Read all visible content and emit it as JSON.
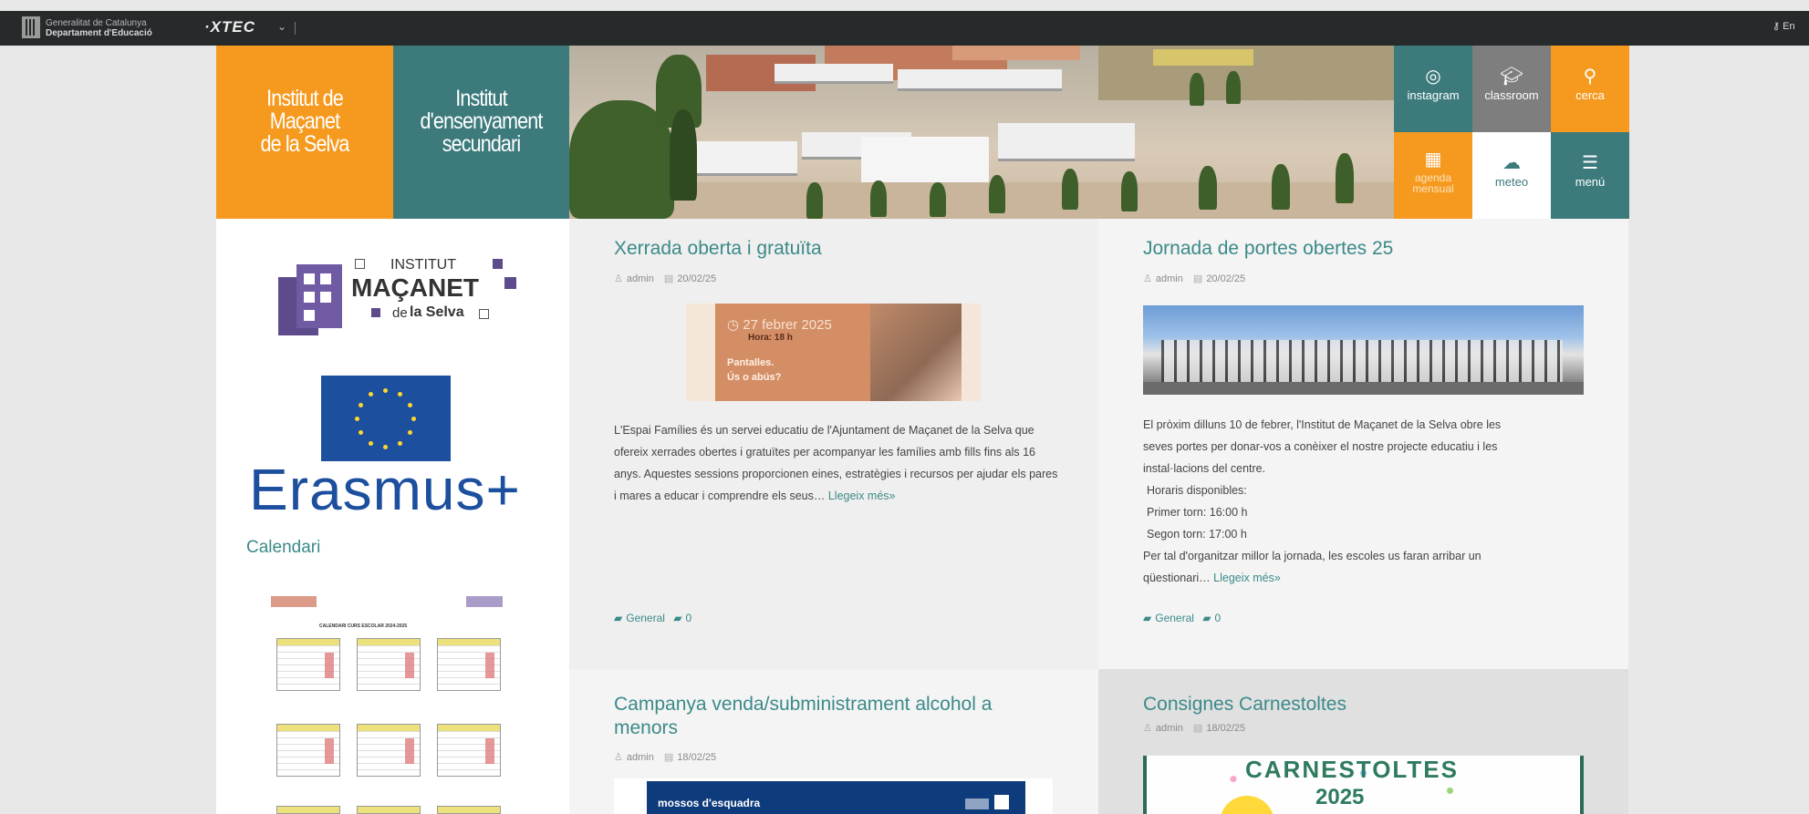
{
  "topbar": {
    "gencat_line1": "Generalitat de Catalunya",
    "gencat_line2": "Departament d'Educació",
    "xtec": "XTEC",
    "login": "En"
  },
  "header": {
    "title_orange": [
      "Institut de",
      "Maçanet",
      "de la Selva"
    ],
    "title_teal": [
      "Institut",
      "d'ensenyament",
      "secundari"
    ],
    "tiles": [
      {
        "label": "instagram",
        "icon": "instagram-icon",
        "color": "#3c7a7c"
      },
      {
        "label": "classroom",
        "icon": "graduation-cap-icon",
        "color": "#7e7e7e"
      },
      {
        "label": "cerca",
        "icon": "search-icon",
        "color": "#f59a1f"
      },
      {
        "label": "agenda mensual",
        "icon": "calendar-icon",
        "color": "#f59a1f"
      },
      {
        "label": "meteo",
        "icon": "cloud-icon",
        "color": "#ffffff"
      },
      {
        "label": "menú",
        "icon": "hamburger-menu-icon",
        "color": "#3c7a7c"
      }
    ]
  },
  "sidebar": {
    "logo_institut": "INSTITUT",
    "logo_macanet": "MAÇANET",
    "logo_de": "de",
    "logo_selva": "la Selva",
    "erasmus": "Erasmus+",
    "calendari_title": "Calendari",
    "calendar_heading": "CALENDARI CURS ESCOLAR 2024-2025"
  },
  "posts": [
    {
      "title": "Xerrada oberta i gratuïta",
      "author": "admin",
      "date": "20/02/25",
      "image_date": "27 febrer 2025",
      "image_time": "Hora: 18 h",
      "image_line1": "Pantalles.",
      "image_line2": "Ús o abús?",
      "body": "L'Espai Famílies és un servei educatiu de l'Ajuntament de Maçanet de la Selva que ofereix xerrades obertes i gratuïtes per acompanyar les famílies amb fills fins als 16 anys. Aquestes sessions proporcionen eines, estratègies i recursos per ajudar els pares i mares a educar i comprendre els seus…",
      "read_more": "Llegeix més»",
      "category": "General",
      "comments": "0"
    },
    {
      "title": "Jornada de portes obertes 25",
      "author": "admin",
      "date": "20/02/25",
      "body_lines": [
        "El pròxim dilluns 10 de febrer, l'Institut de Maçanet de la Selva obre les",
        "seves portes per donar-vos a conèixer el nostre projecte educatiu i les",
        "instal·lacions del centre.",
        "Horaris disponibles:",
        "Primer torn: 16:00 h",
        "Segon torn: 17:00 h",
        "Per tal d'organitzar millor la jornada, les escoles us faran arribar un",
        "qüestionari…"
      ],
      "read_more": "Llegeix més»",
      "category": "General",
      "comments": "0"
    },
    {
      "title": "Campanya venda/subministrament alcohol a menors",
      "author": "admin",
      "date": "18/02/25",
      "image_text": "mossos d'esquadra"
    },
    {
      "title": "Consignes Carnestoltes",
      "author": "admin",
      "date": "18/02/25",
      "image_text1": "CARNESTOLTES",
      "image_text2": "2025"
    }
  ],
  "colors": {
    "orange": "#f59a1f",
    "teal": "#3c7a7c",
    "link": "#3b8a89",
    "eu_blue": "#1d4f9f"
  }
}
